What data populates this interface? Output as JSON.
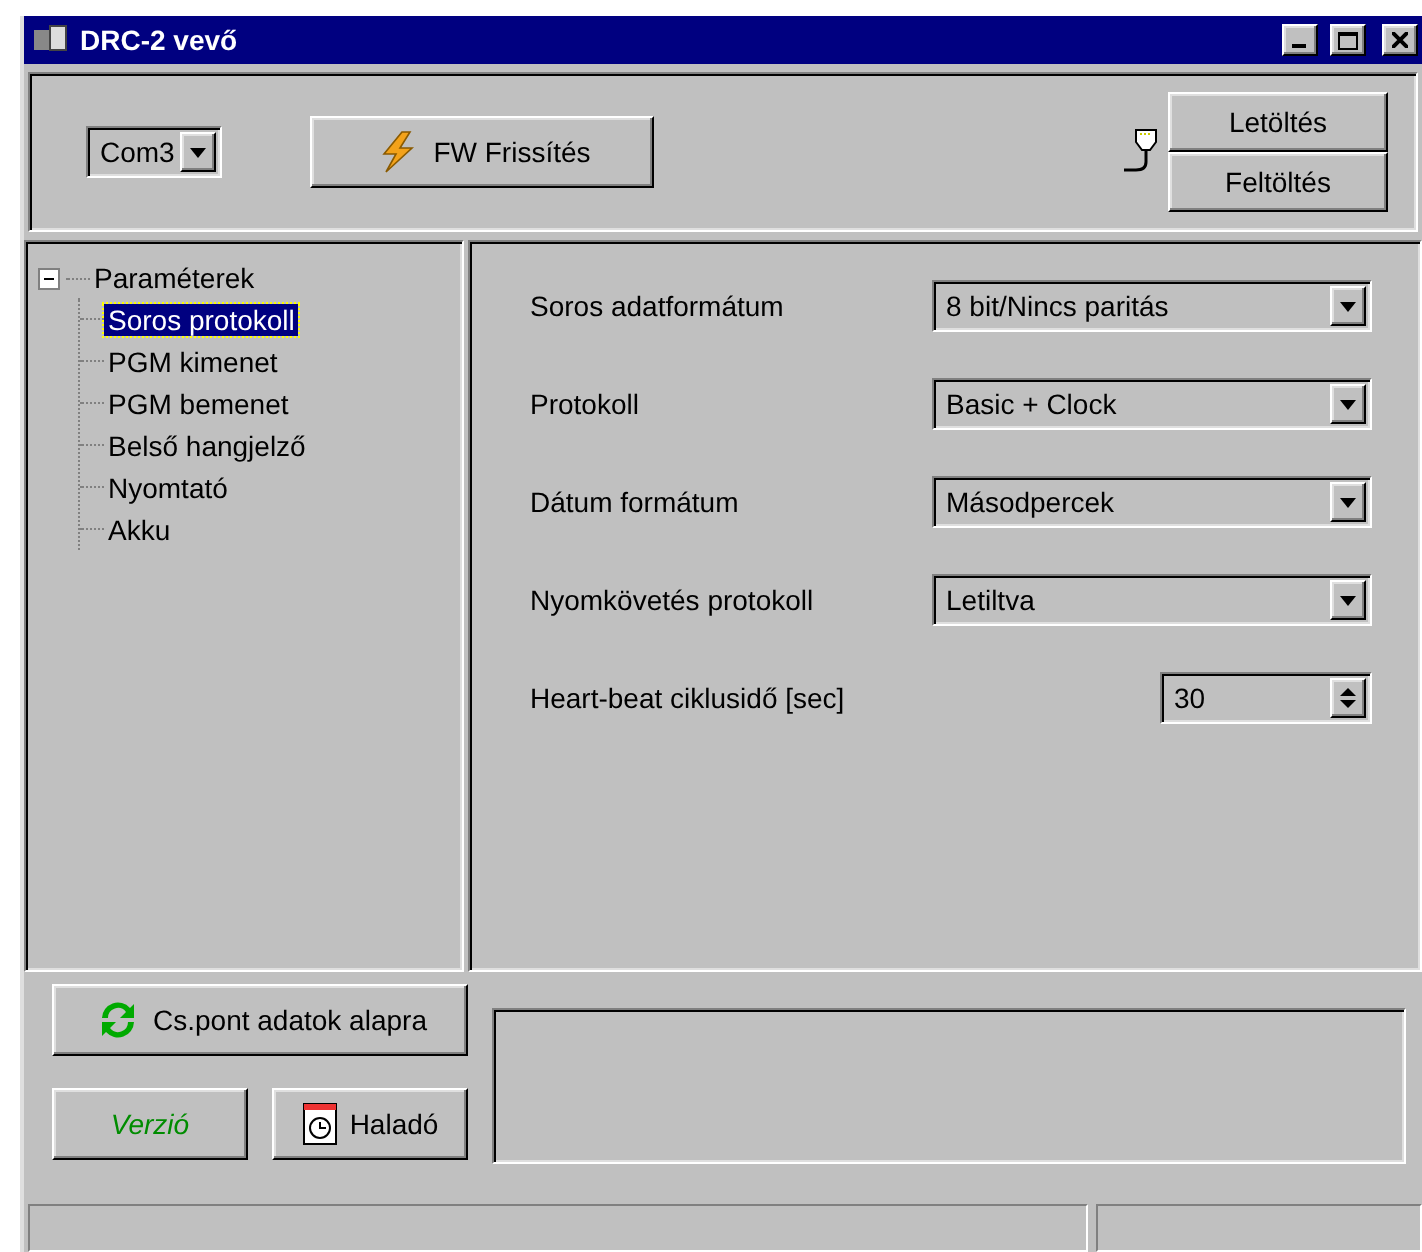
{
  "window": {
    "title": "DRC-2 vevő"
  },
  "toolbar": {
    "port": {
      "value": "Com3"
    },
    "firmware_button": "FW Frissítés",
    "transfer_buttons": [
      "Letöltés",
      "Feltöltés"
    ]
  },
  "tree": [
    {
      "label": "Paraméterek",
      "expanded": true,
      "selected": false,
      "children": [
        {
          "label": "Soros protokoll",
          "selected": true
        },
        {
          "label": "PGM kimenet",
          "selected": false
        },
        {
          "label": "PGM bemenet",
          "selected": false
        },
        {
          "label": "Belső hangjelző",
          "selected": false
        },
        {
          "label": "Nyomtató",
          "selected": false
        },
        {
          "label": "Akku",
          "selected": false
        }
      ]
    }
  ],
  "settings": [
    {
      "label": "Soros adatformátum",
      "kind": "dropdown",
      "value": "8 bit/Nincs paritás"
    },
    {
      "label": "Protokoll",
      "kind": "dropdown",
      "value": "Basic + Clock"
    },
    {
      "label": "Dátum formátum",
      "kind": "dropdown",
      "value": "Másodpercek"
    },
    {
      "label": "Nyomkövetés protokoll",
      "kind": "dropdown",
      "value": "Letiltva"
    },
    {
      "label": "Heart-beat ciklusidő [sec]",
      "kind": "spinner",
      "value": "30"
    }
  ],
  "bottom_buttons": [
    {
      "label": "Cs.pont adatok alapra",
      "kind": "refresh"
    },
    {
      "label": "Verzió",
      "kind": "version"
    },
    {
      "label": "Haladó",
      "kind": "clock"
    }
  ]
}
